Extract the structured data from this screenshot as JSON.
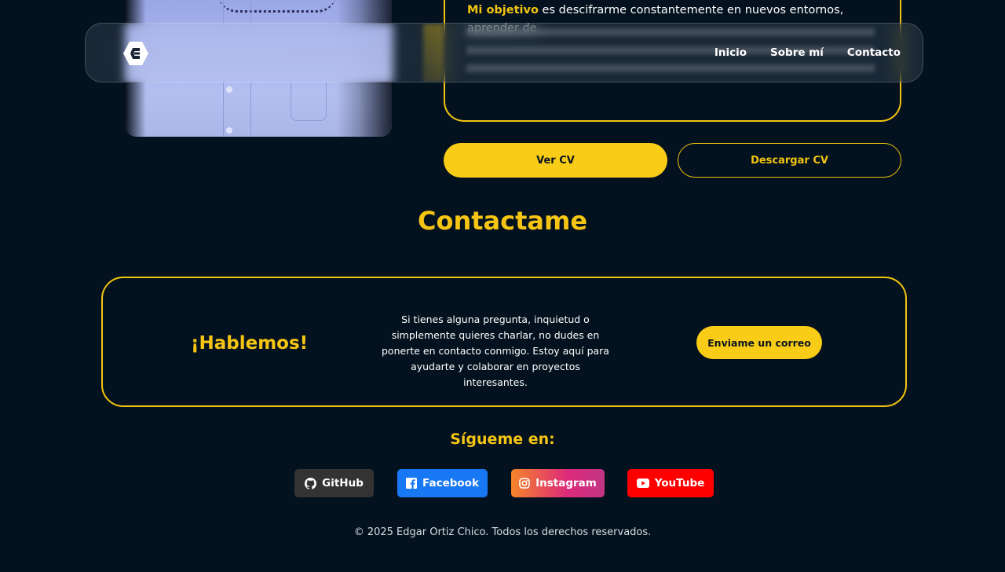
{
  "header": {
    "nav": [
      "Inicio",
      "Sobre mí",
      "Contacto"
    ]
  },
  "about": {
    "objective_highlight": "Mi objetivo",
    "objective_text": " es descifrarme constantemente en nuevos entornos, aprender de"
  },
  "cv": {
    "view_label": "Ver CV",
    "download_label": "Descargar CV"
  },
  "contact": {
    "title": "Contactame",
    "card_heading": "¡Hablemos!",
    "card_text": "Si tienes alguna pregunta, inquietud o simplemente quieres charlar, no dudes en ponerte en contacto conmigo. Estoy aquí para ayudarte y colaborar en proyectos interesantes.",
    "mail_button": "Enviame un correo"
  },
  "social": {
    "heading": "Sígueme en:",
    "links": [
      {
        "label": "GitHub",
        "icon": "github-icon",
        "color": "#333333"
      },
      {
        "label": "Facebook",
        "icon": "facebook-icon",
        "color": "#1877f2"
      },
      {
        "label": "Instagram",
        "icon": "instagram-icon",
        "color": "#dd2a7b"
      },
      {
        "label": "YouTube",
        "icon": "youtube-icon",
        "color": "#ff0000"
      }
    ]
  },
  "footer": {
    "text": "© 2025 Edgar Ortiz Chico. Todos los derechos reservados."
  },
  "colors": {
    "background": "#04121f",
    "accent": "#f2c40f"
  }
}
